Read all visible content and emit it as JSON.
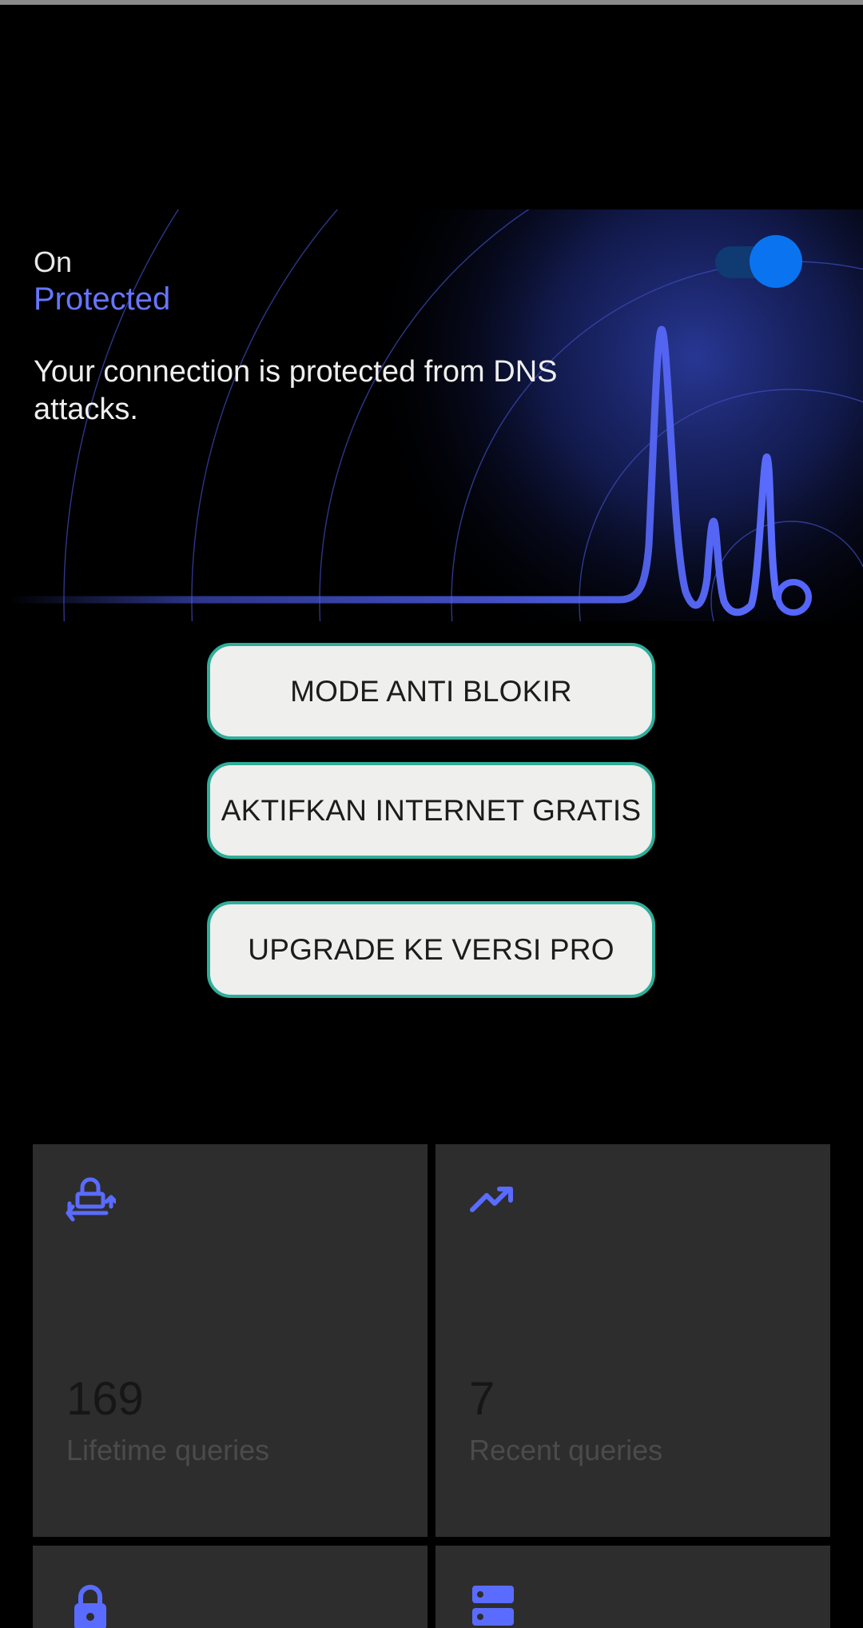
{
  "status_card": {
    "state": "On",
    "status": "Protected",
    "description": "Your connection is protected from DNS attacks.",
    "toggle": {
      "on": true,
      "icon": "toggle-switch"
    },
    "accent_color": "#6676ff"
  },
  "actions": {
    "anti_block_label": "MODE ANTI BLOKIR",
    "free_internet_label": "AKTIFKAN INTERNET GRATIS",
    "upgrade_label": "UPGRADE KE VERSI PRO",
    "border_color": "#2fae9a"
  },
  "stats": [
    {
      "icon": "lock-transfer-icon",
      "value": "169",
      "caption": "Lifetime queries"
    },
    {
      "icon": "trending-up-icon",
      "value": "7",
      "caption": "Recent queries"
    },
    {
      "icon": "lock-icon"
    },
    {
      "icon": "server-icon"
    }
  ]
}
